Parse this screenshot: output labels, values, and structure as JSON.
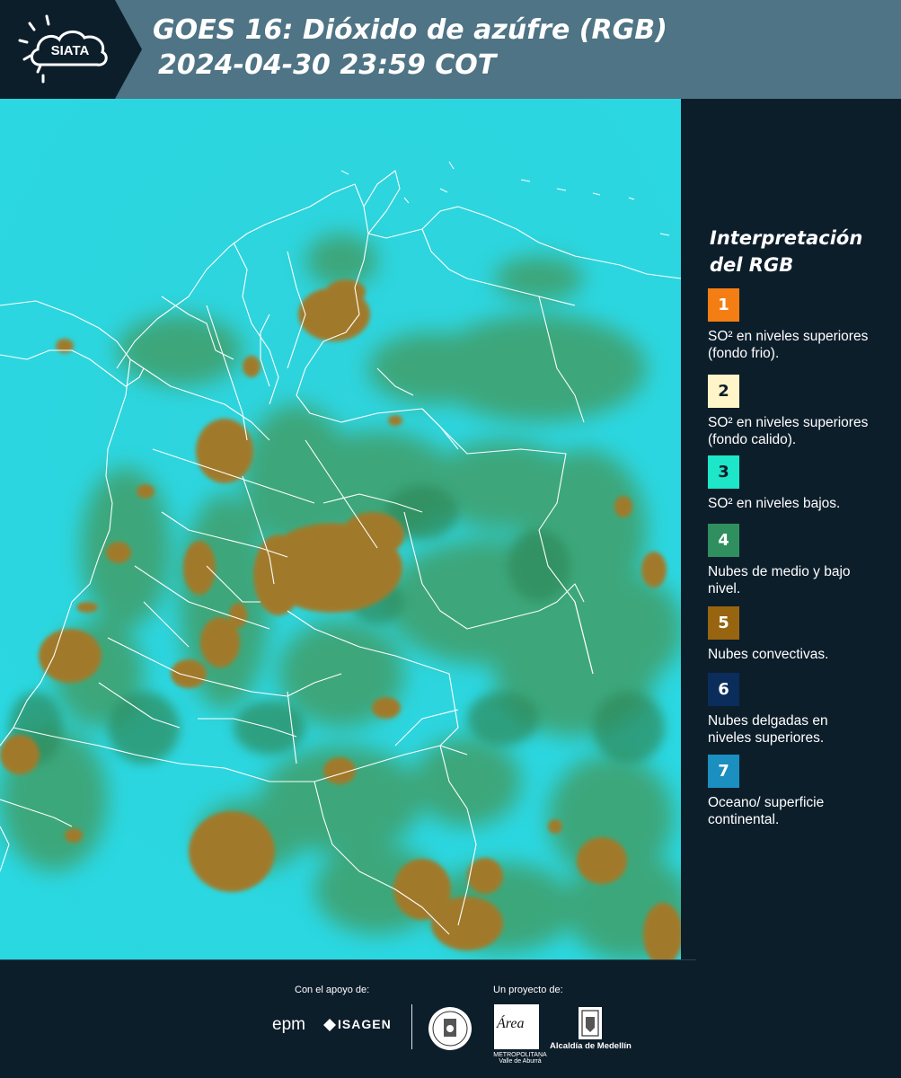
{
  "header": {
    "logo_text": "SIATA",
    "title_line1": "GOES 16: Dióxido de azúfre (RGB)",
    "title_line2": "2024-04-30 23:59 COT",
    "background_color": "#4e7485",
    "logo_background_color": "#0d1e2b"
  },
  "map": {
    "description_icon": "satellite-rgb-map",
    "background_color": "#2fd8de",
    "cloud_color": "#9c7c2c",
    "vegetation_color": "#3a9c6a",
    "border_color": "#ffffff"
  },
  "legend": {
    "title": "Interpretación del RGB",
    "items": [
      {
        "number": "1",
        "text": "SO² en niveles superiores (fondo frio).",
        "color": "#f57e14"
      },
      {
        "number": "2",
        "text": "SO² en niveles superiores (fondo calido).",
        "color": "#fff5c8"
      },
      {
        "number": "3",
        "text": "SO² en niveles bajos.",
        "color": "#1ee6c8"
      },
      {
        "number": "4",
        "text": "Nubes de medio y bajo nivel.",
        "color": "#2f8f5f"
      },
      {
        "number": "5",
        "text": "Nubes convectivas.",
        "color": "#97650f"
      },
      {
        "number": "6",
        "text": "Nubes delgadas en niveles superiores.",
        "color": "#0a2d5c"
      },
      {
        "number": "7",
        "text": "Oceano/ superficie continental.",
        "color": "#1a8fc0"
      }
    ]
  },
  "footer": {
    "support_label": "Con el apoyo de:",
    "project_label": "Un proyecto de:",
    "epm_label": "epm",
    "isagen_label": "ISAGEN",
    "area_word": "Área",
    "area_sub": "METROPOLITANA Valle de Aburrá",
    "alcaldia_label": "Alcaldía de Medellín"
  }
}
